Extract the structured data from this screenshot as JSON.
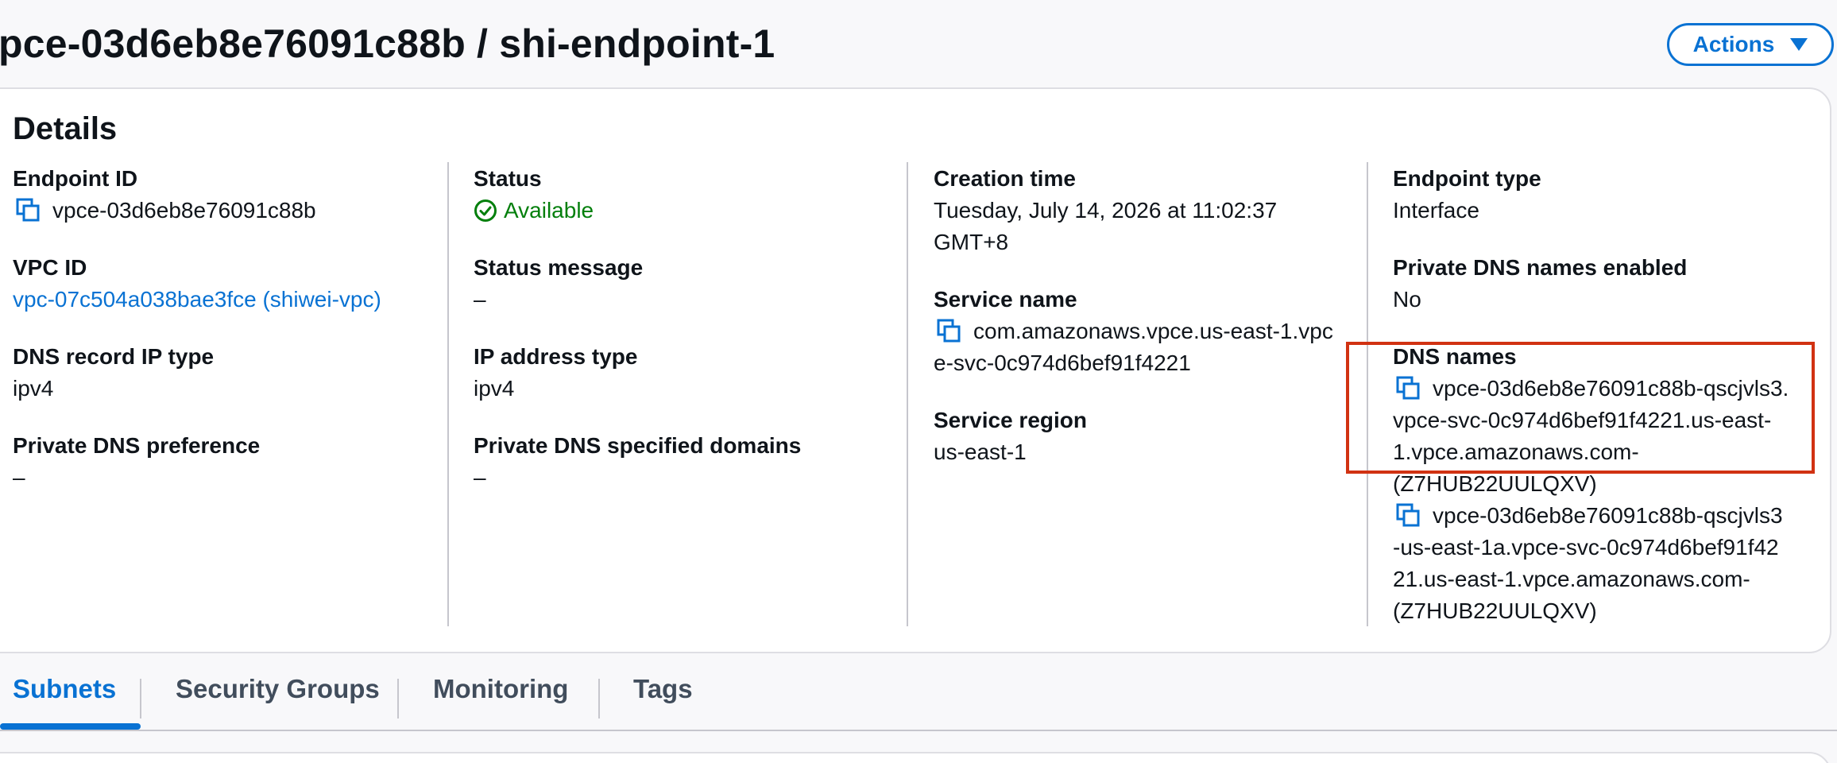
{
  "header": {
    "title": "pce-03d6eb8e76091c88b / shi-endpoint-1",
    "actions_label": "Actions"
  },
  "details": {
    "title": "Details",
    "columns": [
      {
        "fields": [
          {
            "label": "Endpoint ID",
            "value": "vpce-03d6eb8e76091c88b",
            "copy": true
          },
          {
            "label": "VPC ID",
            "value": "vpc-07c504a038bae3fce (shiwei-vpc)",
            "link": true
          },
          {
            "label": "DNS record IP type",
            "value": "ipv4"
          },
          {
            "label": "Private DNS preference",
            "value": "–"
          }
        ]
      },
      {
        "fields": [
          {
            "label": "Status",
            "value": "Available",
            "status": "success"
          },
          {
            "label": "Status message",
            "value": "–"
          },
          {
            "label": "IP address type",
            "value": "ipv4"
          },
          {
            "label": "Private DNS specified domains",
            "value": "–"
          }
        ]
      },
      {
        "fields": [
          {
            "label": "Creation time",
            "lines": [
              "Tuesday, July 14, 2026 at 11:02:37",
              "GMT+8"
            ]
          },
          {
            "label": "Service name",
            "lines": [
              "com.amazonaws.vpce.us-east-1.vpc",
              "e-svc-0c974d6bef91f4221"
            ],
            "copy": true
          },
          {
            "label": "Service region",
            "value": "us-east-1"
          }
        ]
      },
      {
        "fields": [
          {
            "label": "Endpoint type",
            "value": "Interface"
          },
          {
            "label": "Private DNS names enabled",
            "value": "No"
          },
          {
            "label": "DNS names",
            "entries": [
              {
                "lines": [
                  "vpce-03d6eb8e76091c88b-qscjvls3.",
                  "vpce-svc-0c974d6bef91f4221.us-east-",
                  "1.vpce.amazonaws.com-",
                  "(Z7HUB22UULQXV)"
                ]
              },
              {
                "lines": [
                  "vpce-03d6eb8e76091c88b-qscjvls3",
                  "-us-east-1a.vpce-svc-0c974d6bef91f42",
                  "21.us-east-1.vpce.amazonaws.com-",
                  "(Z7HUB22UULQXV)"
                ]
              }
            ]
          }
        ]
      }
    ]
  },
  "tabs": [
    {
      "label": "Subnets",
      "active": true
    },
    {
      "label": "Security Groups",
      "active": false
    },
    {
      "label": "Monitoring",
      "active": false
    },
    {
      "label": "Tags",
      "active": false
    }
  ],
  "colors": {
    "accent": "#0972d3",
    "success": "#037f0c",
    "highlight": "#d13212"
  },
  "icons": {
    "copy": "copy-icon",
    "status": "check-circle-icon",
    "dropdown": "caret-down-icon"
  }
}
